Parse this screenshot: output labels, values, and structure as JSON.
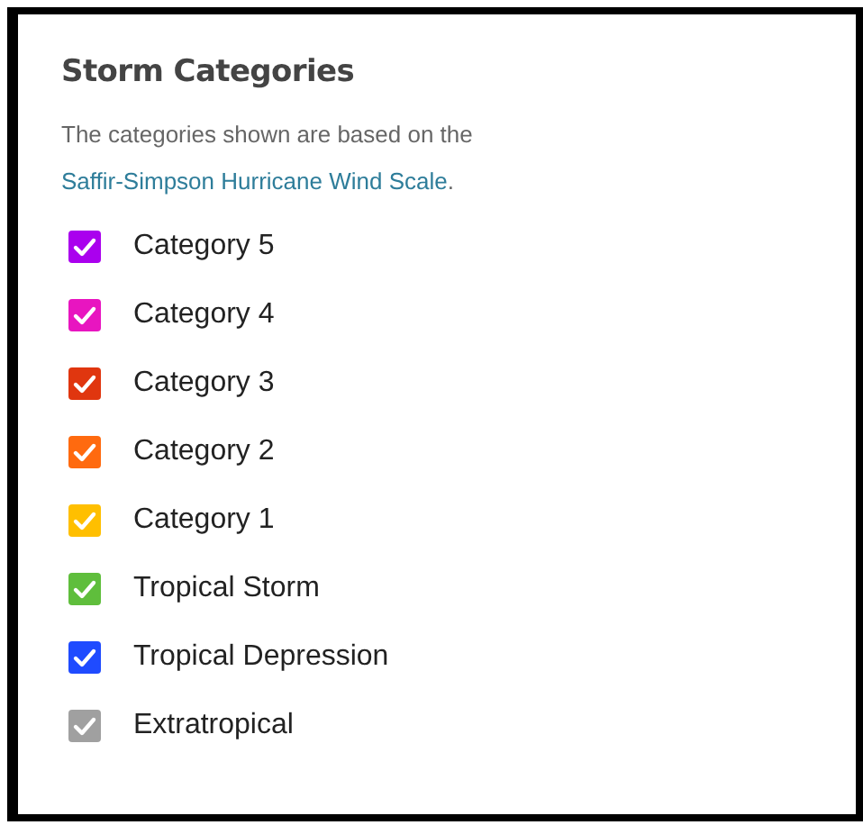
{
  "panel": {
    "title": "Storm Categories",
    "description": {
      "text": "The categories shown are based on the ",
      "link": "Saffir-Simpson Hurricane Wind Scale",
      "end": "."
    }
  },
  "categories": [
    {
      "label": "Category 5",
      "checked": true,
      "color": "#aa00ee"
    },
    {
      "label": "Category 4",
      "checked": true,
      "color": "#e815c0"
    },
    {
      "label": "Category 3",
      "checked": true,
      "color": "#e0360f"
    },
    {
      "label": "Category 2",
      "checked": true,
      "color": "#ff6a0f"
    },
    {
      "label": "Category 1",
      "checked": true,
      "color": "#ffbf00"
    },
    {
      "label": "Tropical Storm",
      "checked": true,
      "color": "#5fbe3c"
    },
    {
      "label": "Tropical Depression",
      "checked": true,
      "color": "#1f4bff"
    },
    {
      "label": "Extratropical",
      "checked": true,
      "color": "#a0a0a0"
    }
  ]
}
